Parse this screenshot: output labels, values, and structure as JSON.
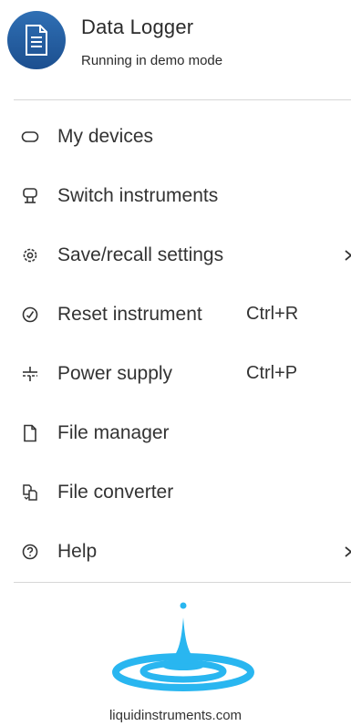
{
  "header": {
    "title": "Data Logger",
    "subtitle": "Running in demo mode",
    "icon": "document-icon",
    "icon_color": "#2563a8"
  },
  "menu": {
    "items": [
      {
        "label": "My devices",
        "icon": "device-icon",
        "shortcut": "",
        "submenu": false
      },
      {
        "label": "Switch instruments",
        "icon": "switch-instruments-icon",
        "shortcut": "",
        "submenu": false
      },
      {
        "label": "Save/recall settings",
        "icon": "gear-icon",
        "shortcut": "",
        "submenu": true
      },
      {
        "label": "Reset instrument",
        "icon": "reset-icon",
        "shortcut": "Ctrl+R",
        "submenu": false
      },
      {
        "label": "Power supply",
        "icon": "power-supply-icon",
        "shortcut": "Ctrl+P",
        "submenu": false
      },
      {
        "label": "File manager",
        "icon": "file-icon",
        "shortcut": "",
        "submenu": false
      },
      {
        "label": "File converter",
        "icon": "file-converter-icon",
        "shortcut": "",
        "submenu": false
      },
      {
        "label": "Help",
        "icon": "help-icon",
        "shortcut": "",
        "submenu": true
      }
    ]
  },
  "footer": {
    "logo": "liquid-instruments-logo",
    "logo_color": "#29b6f0",
    "website": "liquidinstruments.com"
  }
}
